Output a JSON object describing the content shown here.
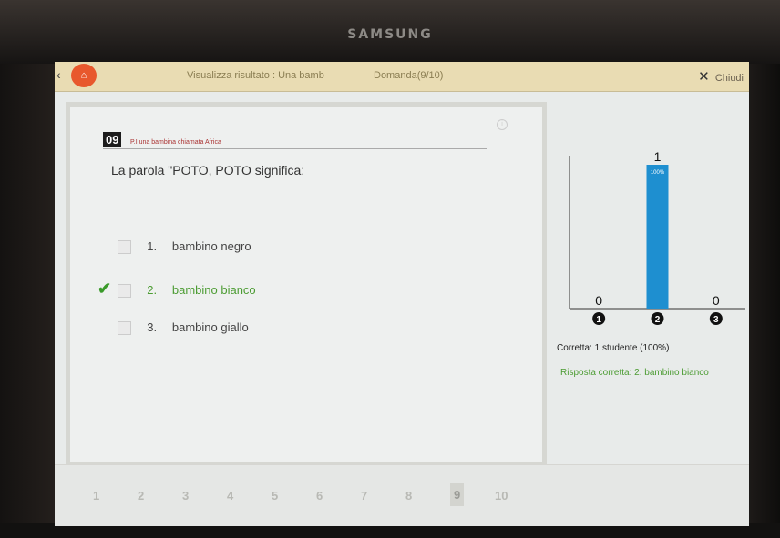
{
  "device": {
    "brand": "SAMSUNG"
  },
  "header": {
    "title": "Visualizza risultato : Una bamb",
    "question_counter": "Domanda(9/10)",
    "close_label": "Chiudi"
  },
  "question": {
    "number": "09",
    "category": "P.I una bambina chiamata Africa",
    "text": "La parola \"POTO, POTO significa:",
    "options": [
      {
        "num": "1.",
        "label": "bambino negro",
        "correct": false
      },
      {
        "num": "2.",
        "label": "bambino bianco",
        "correct": true
      },
      {
        "num": "3.",
        "label": "bambino giallo",
        "correct": false
      }
    ]
  },
  "chart_data": {
    "type": "bar",
    "categories": [
      "1",
      "2",
      "3"
    ],
    "values": [
      0,
      1,
      0
    ],
    "data_labels": [
      "0",
      "1",
      "0"
    ],
    "percent_labels": [
      "",
      "100%",
      ""
    ],
    "bar_color": "#1e8fd0",
    "ylim": [
      0,
      1
    ]
  },
  "summary": {
    "correct_count": "Corretta: 1 studente (100%)",
    "correct_answer": "Risposta corretta: 2. bambino bianco"
  },
  "pager": {
    "pages": [
      "1",
      "2",
      "3",
      "4",
      "5",
      "6",
      "7",
      "8",
      "9",
      "10"
    ],
    "current_index": 8
  }
}
